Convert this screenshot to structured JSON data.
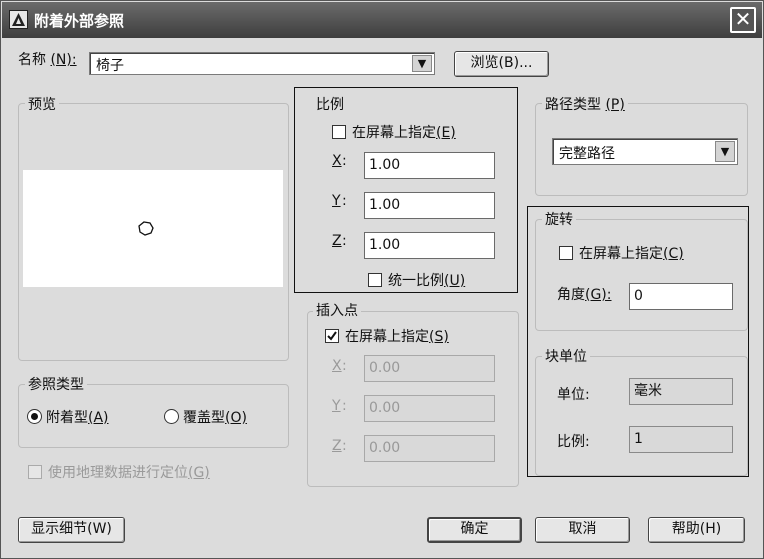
{
  "title": "附着外部参照",
  "name_label": "名称",
  "name_hotkey": "(N):",
  "name_value": "椅子",
  "browse_button": "浏览(B)...",
  "preview_title": "预览",
  "scale": {
    "title": "比例",
    "specify_on_screen": "在屏幕上指定",
    "specify_hotkey": "(E)",
    "x_label": "X",
    "y_label": "Y",
    "z_label": "Z",
    "x_value": "1.00",
    "y_value": "1.00",
    "z_value": "1.00",
    "uniform": "统一比例",
    "uniform_hotkey": "(U)"
  },
  "path_type": {
    "title": "路径类型",
    "title_hotkey": "(P)",
    "value": "完整路径"
  },
  "rotation": {
    "title": "旋转",
    "specify_on_screen": "在屏幕上指定",
    "specify_hotkey": "(C)",
    "angle_label": "角度",
    "angle_hotkey": "(G):",
    "angle_value": "0"
  },
  "block_unit": {
    "title": "块单位",
    "unit_label": "单位:",
    "unit_value": "毫米",
    "scale_label": "比例:",
    "scale_value": "1"
  },
  "insertion_point": {
    "title": "插入点",
    "specify_on_screen": "在屏幕上指定",
    "specify_hotkey": "(S)",
    "x_label": "X",
    "y_label": "Y",
    "z_label": "Z",
    "x_value": "0.00",
    "y_value": "0.00",
    "z_value": "0.00"
  },
  "reference_type": {
    "title": "参照类型",
    "attachment": "附着型",
    "attachment_hotkey": "(A)",
    "overlay": "覆盖型",
    "overlay_hotkey": "(O)"
  },
  "geo_locate": "使用地理数据进行定位",
  "geo_locate_hotkey": "(G)",
  "show_details": "显示细节(W)",
  "ok": "确定",
  "cancel": "取消",
  "help": "帮助(H)"
}
